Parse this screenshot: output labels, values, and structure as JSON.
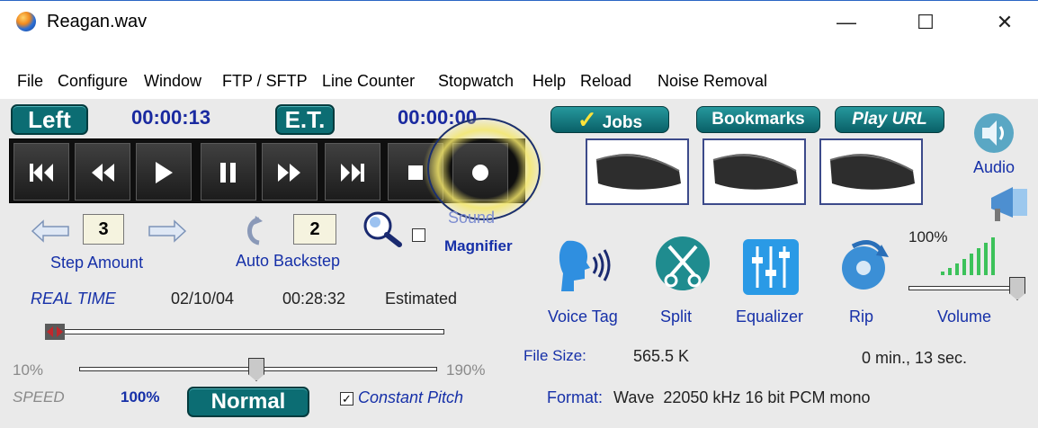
{
  "window": {
    "title": "Reagan.wav",
    "controls": {
      "minimize": "—",
      "maximize": "☐",
      "close": "✕"
    }
  },
  "menu": [
    "File",
    "Configure",
    "Window",
    "FTP / SFTP",
    "Line Counter",
    "Stopwatch",
    "Help",
    "Reload",
    "Noise Removal"
  ],
  "timers": {
    "left_label": "Left",
    "left_time": "00:00:13",
    "et_label": "E.T.",
    "et_time": "00:00:00"
  },
  "transport": {
    "buttons": [
      "skip-to-start",
      "rewind",
      "play",
      "pause",
      "fast-forward",
      "skip-to-end",
      "stop",
      "record"
    ],
    "highlight_color": "#f4e76a"
  },
  "step": {
    "value": "3",
    "label": "Step Amount"
  },
  "backstep": {
    "value": "2",
    "label": "Auto Backstep"
  },
  "magnifier": {
    "label_line1": "Sound",
    "label_line2": "Magnifier",
    "checked": false
  },
  "realtime": {
    "label": "REAL TIME",
    "date": "02/10/04",
    "time": "00:28:32",
    "status": "Estimated"
  },
  "speed": {
    "min_label": "10%",
    "max_label": "190%",
    "label": "SPEED",
    "value": "100%",
    "normal_button": "Normal",
    "constant_pitch_label": "Constant Pitch",
    "constant_pitch_checked": true
  },
  "top_buttons": {
    "jobs": "Jobs",
    "bookmarks": "Bookmarks",
    "play_url": "Play URL"
  },
  "audio": {
    "label": "Audio"
  },
  "tools": {
    "voice_tag": "Voice Tag",
    "split": "Split",
    "equalizer": "Equalizer",
    "rip": "Rip",
    "volume_label": "Volume",
    "volume_value": "100%"
  },
  "file_info": {
    "size_label": "File Size:",
    "size_value": "565.5 K",
    "duration": "0 min., 13 sec.",
    "format_label": "Format:",
    "format_value": "Wave  22050 kHz 16 bit PCM mono"
  },
  "colors": {
    "accent_blue": "#1630a8",
    "teal": "#0c6d73",
    "panel_bg": "#eaeaea"
  }
}
